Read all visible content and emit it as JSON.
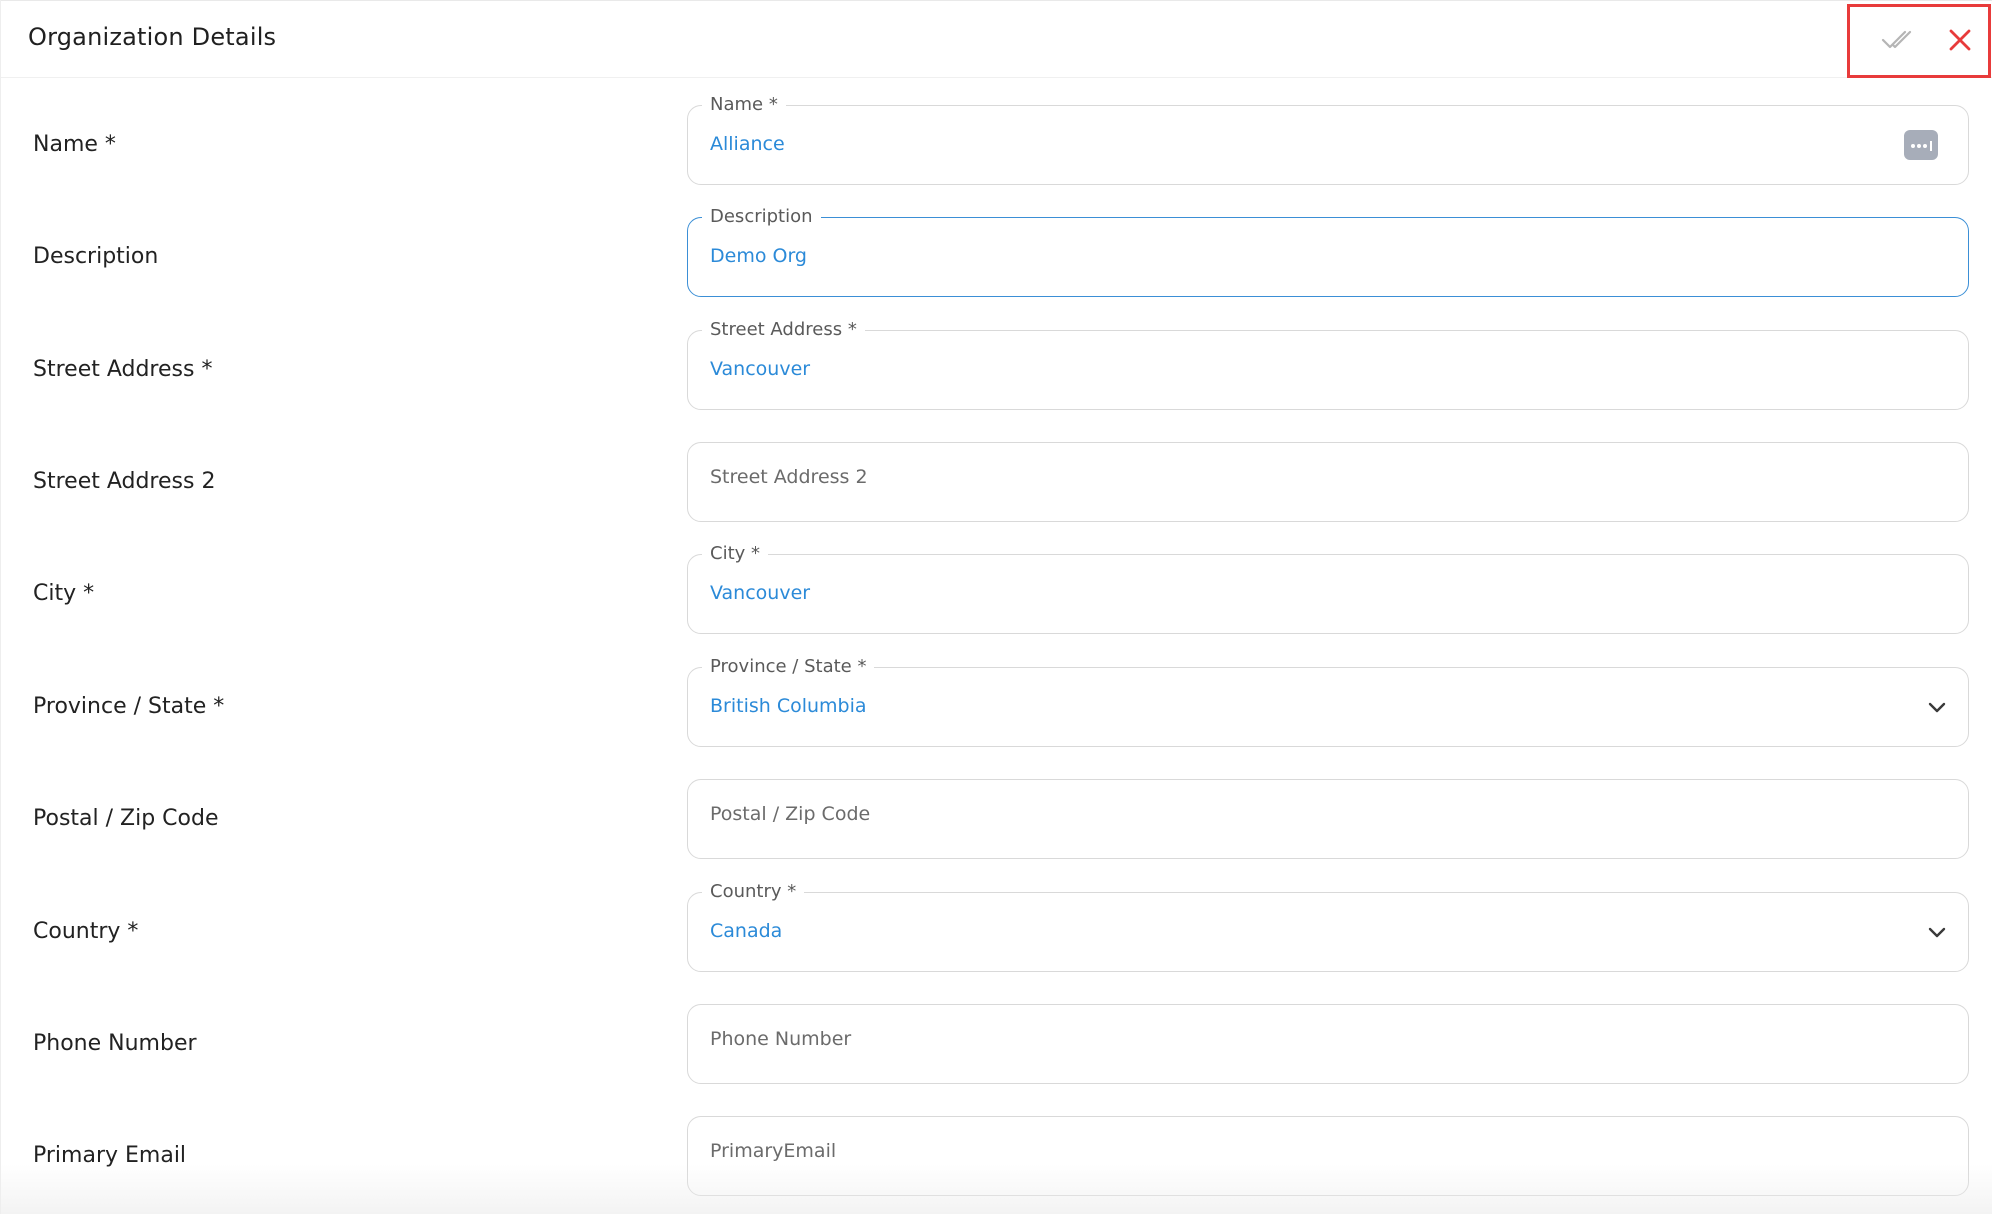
{
  "header": {
    "title": "Organization Details",
    "save_icon": "double-check-icon",
    "close_icon": "close-icon",
    "close_color": "#e83b3b",
    "highlight_color": "#e83b3b"
  },
  "accent_color": "#2b8ad8",
  "form": {
    "name": {
      "label": "Name *",
      "legend": "Name *",
      "value": "Alliance",
      "action_icon": "more-dots-icon"
    },
    "description": {
      "label": "Description",
      "legend": "Description",
      "value": "Demo Org"
    },
    "street_address": {
      "label": "Street Address *",
      "legend": "Street Address *",
      "value": "Vancouver"
    },
    "street_address_2": {
      "label": "Street Address 2",
      "placeholder": "Street Address 2"
    },
    "city": {
      "label": "City *",
      "legend": "City *",
      "value": "Vancouver"
    },
    "province_state": {
      "label": "Province / State *",
      "legend": "Province / State *",
      "value": "British Columbia"
    },
    "postal_zip": {
      "label": "Postal / Zip Code",
      "placeholder": "Postal / Zip Code"
    },
    "country": {
      "label": "Country *",
      "legend": "Country *",
      "value": "Canada"
    },
    "phone_number": {
      "label": "Phone Number",
      "placeholder": "Phone Number"
    },
    "primary_email": {
      "label": "Primary Email",
      "placeholder": "PrimaryEmail"
    }
  }
}
